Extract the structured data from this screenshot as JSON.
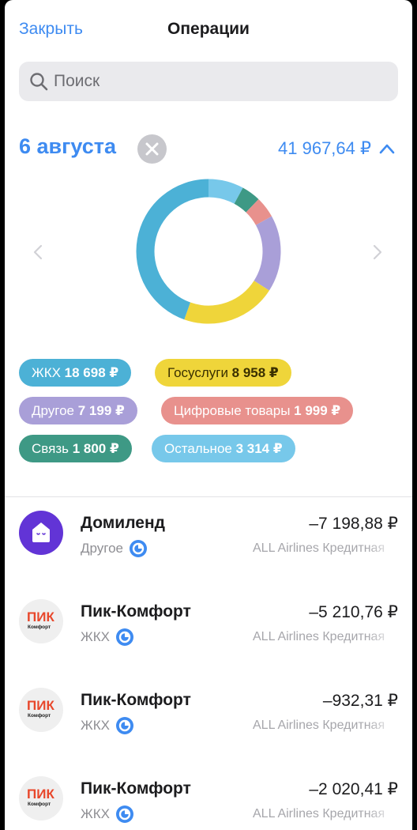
{
  "header": {
    "close_label": "Закрыть",
    "title": "Операции"
  },
  "search": {
    "placeholder": "Поиск",
    "value": ""
  },
  "summary": {
    "date": "6 августа",
    "total": "41 967,64 ₽"
  },
  "chart_data": {
    "type": "pie",
    "donut": true,
    "unit": "₽",
    "categories": [
      "ЖКХ",
      "Госуслуги",
      "Другое",
      "Цифровые товары",
      "Связь",
      "Остальное"
    ],
    "values": [
      18698,
      8958,
      7199,
      1999,
      1800,
      3314
    ],
    "colors": [
      "#4cb1d6",
      "#efd53a",
      "#a99fd8",
      "#e8918d",
      "#3e9985",
      "#77c8ea"
    ],
    "start_order": [
      "Остальное",
      "Связь",
      "Цифровые товары",
      "Другое",
      "Госуслуги",
      "ЖКХ"
    ]
  },
  "chips": [
    {
      "label": "ЖКХ",
      "value": "18 698 ₽",
      "color": "#4cb1d6",
      "text_color": "#ffffff"
    },
    {
      "label": "Госуслуги",
      "value": "8 958 ₽",
      "color": "#efd53a",
      "text_color": "#3a3000"
    },
    {
      "label": "Другое",
      "value": "7 199 ₽",
      "color": "#a99fd8",
      "text_color": "#ffffff"
    },
    {
      "label": "Цифровые товары",
      "value": "1 999 ₽",
      "color": "#e8918d",
      "text_color": "#ffffff"
    },
    {
      "label": "Связь",
      "value": "1 800 ₽",
      "color": "#3e9985",
      "text_color": "#ffffff"
    },
    {
      "label": "Остальное",
      "value": "3 314 ₽",
      "color": "#77c8ea",
      "text_color": "#ffffff"
    }
  ],
  "operations": [
    {
      "name": "Домиленд",
      "category": "Другое",
      "amount": "–7 198,88 ₽",
      "account": "ALL Airlines Кредитная",
      "logo": "domilend"
    },
    {
      "name": "Пик-Комфорт",
      "category": "ЖКХ",
      "amount": "–5 210,76 ₽",
      "account": "ALL Airlines Кредитная",
      "logo": "pik"
    },
    {
      "name": "Пик-Комфорт",
      "category": "ЖКХ",
      "amount": "–932,31 ₽",
      "account": "ALL Airlines Кредитная",
      "logo": "pik"
    },
    {
      "name": "Пик-Комфорт",
      "category": "ЖКХ",
      "amount": "–2 020,41 ₽",
      "account": "ALL Airlines Кредитная",
      "logo": "pik"
    }
  ],
  "logos": {
    "pik_word": "ПИК",
    "pik_sub": "Комфорт"
  },
  "colors": {
    "accent": "#3e8bf1",
    "category_icon": "#3e8bf1"
  }
}
